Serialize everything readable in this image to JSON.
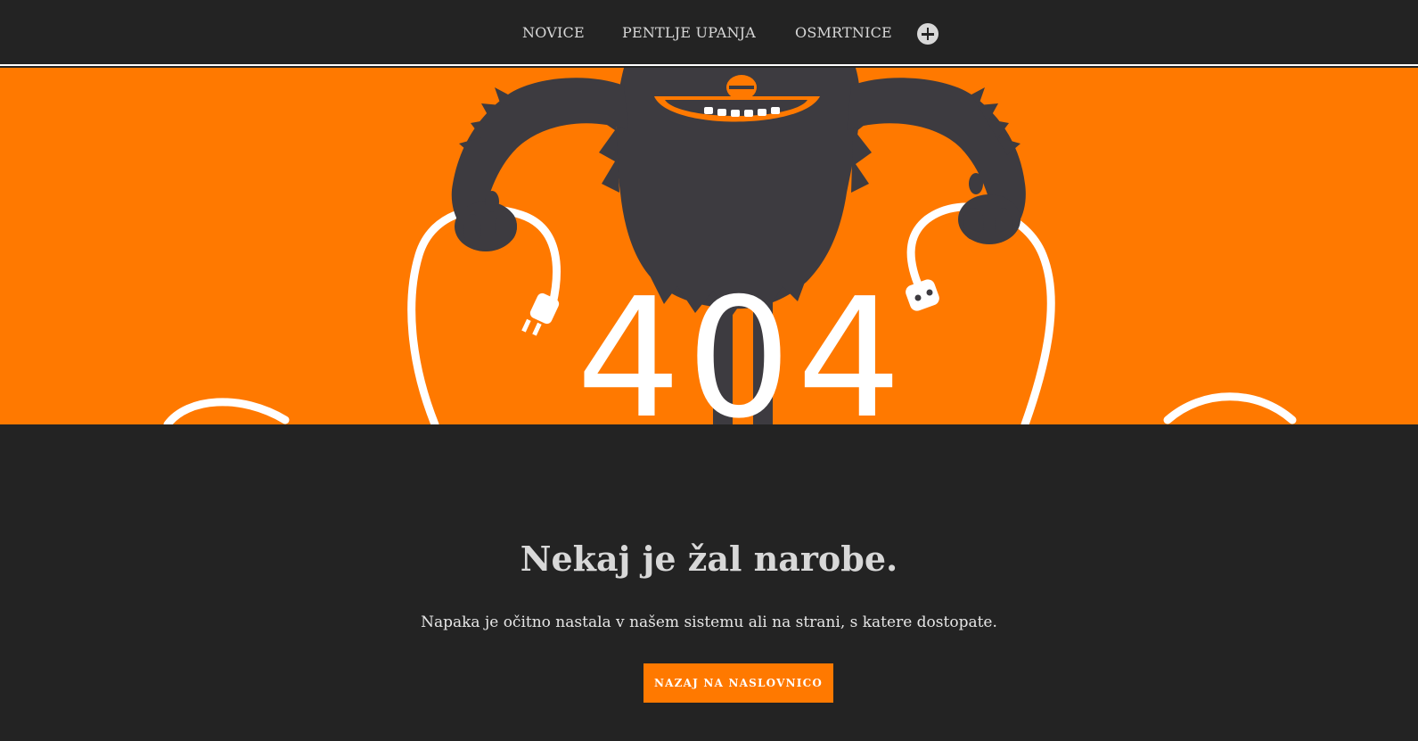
{
  "nav": {
    "items": [
      {
        "label": "NOVICE"
      },
      {
        "label": "PENTLJE UPANJA"
      },
      {
        "label": "OSMRTNICE"
      }
    ],
    "more_icon": "plus-circle-icon"
  },
  "hero": {
    "code": "404",
    "background_color": "#ff7900",
    "monster_color": "#3d3b40",
    "illustration": "monster-with-cables"
  },
  "error": {
    "title": "Nekaj je žal narobe.",
    "message": "Napaka je očitno nastala v našem sistemu ali na strani, s katere dostopate.",
    "button_label": "NAZAJ NA NASLOVNICO"
  }
}
